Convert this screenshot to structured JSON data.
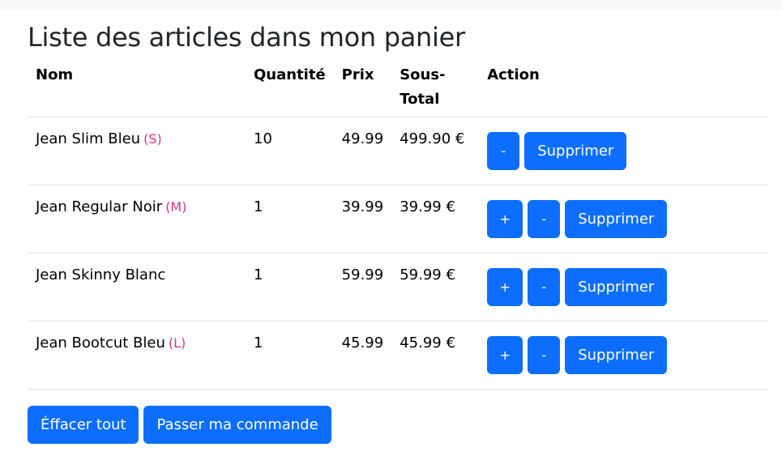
{
  "page": {
    "title": "Liste des articles dans mon panier"
  },
  "table": {
    "headers": {
      "nom": "Nom",
      "quantite": "Quantité",
      "prix": "Prix",
      "sous_total_1": "Sous-",
      "sous_total_2": "Total",
      "action": "Action"
    },
    "rows": [
      {
        "name": "Jean Slim Bleu",
        "size": "(S)",
        "qty": "10",
        "price": "49.99",
        "subtotal": "499.90 €",
        "has_plus": false
      },
      {
        "name": "Jean Regular Noir",
        "size": "(M)",
        "qty": "1",
        "price": "39.99",
        "subtotal": "39.99 €",
        "has_plus": true
      },
      {
        "name": "Jean Skinny Blanc",
        "size": "",
        "qty": "1",
        "price": "59.99",
        "subtotal": "59.99 €",
        "has_plus": true
      },
      {
        "name": "Jean Bootcut Bleu",
        "size": "(L)",
        "qty": "1",
        "price": "45.99",
        "subtotal": "45.99 €",
        "has_plus": true
      }
    ],
    "buttons": {
      "plus": "+",
      "minus": "-",
      "delete": "Supprimer"
    }
  },
  "footer": {
    "clear_all": "Éffacer tout",
    "checkout": "Passer ma commande"
  },
  "colors": {
    "primary": "#0d6efd",
    "size_accent": "#d63384",
    "border": "#dee2e6"
  }
}
